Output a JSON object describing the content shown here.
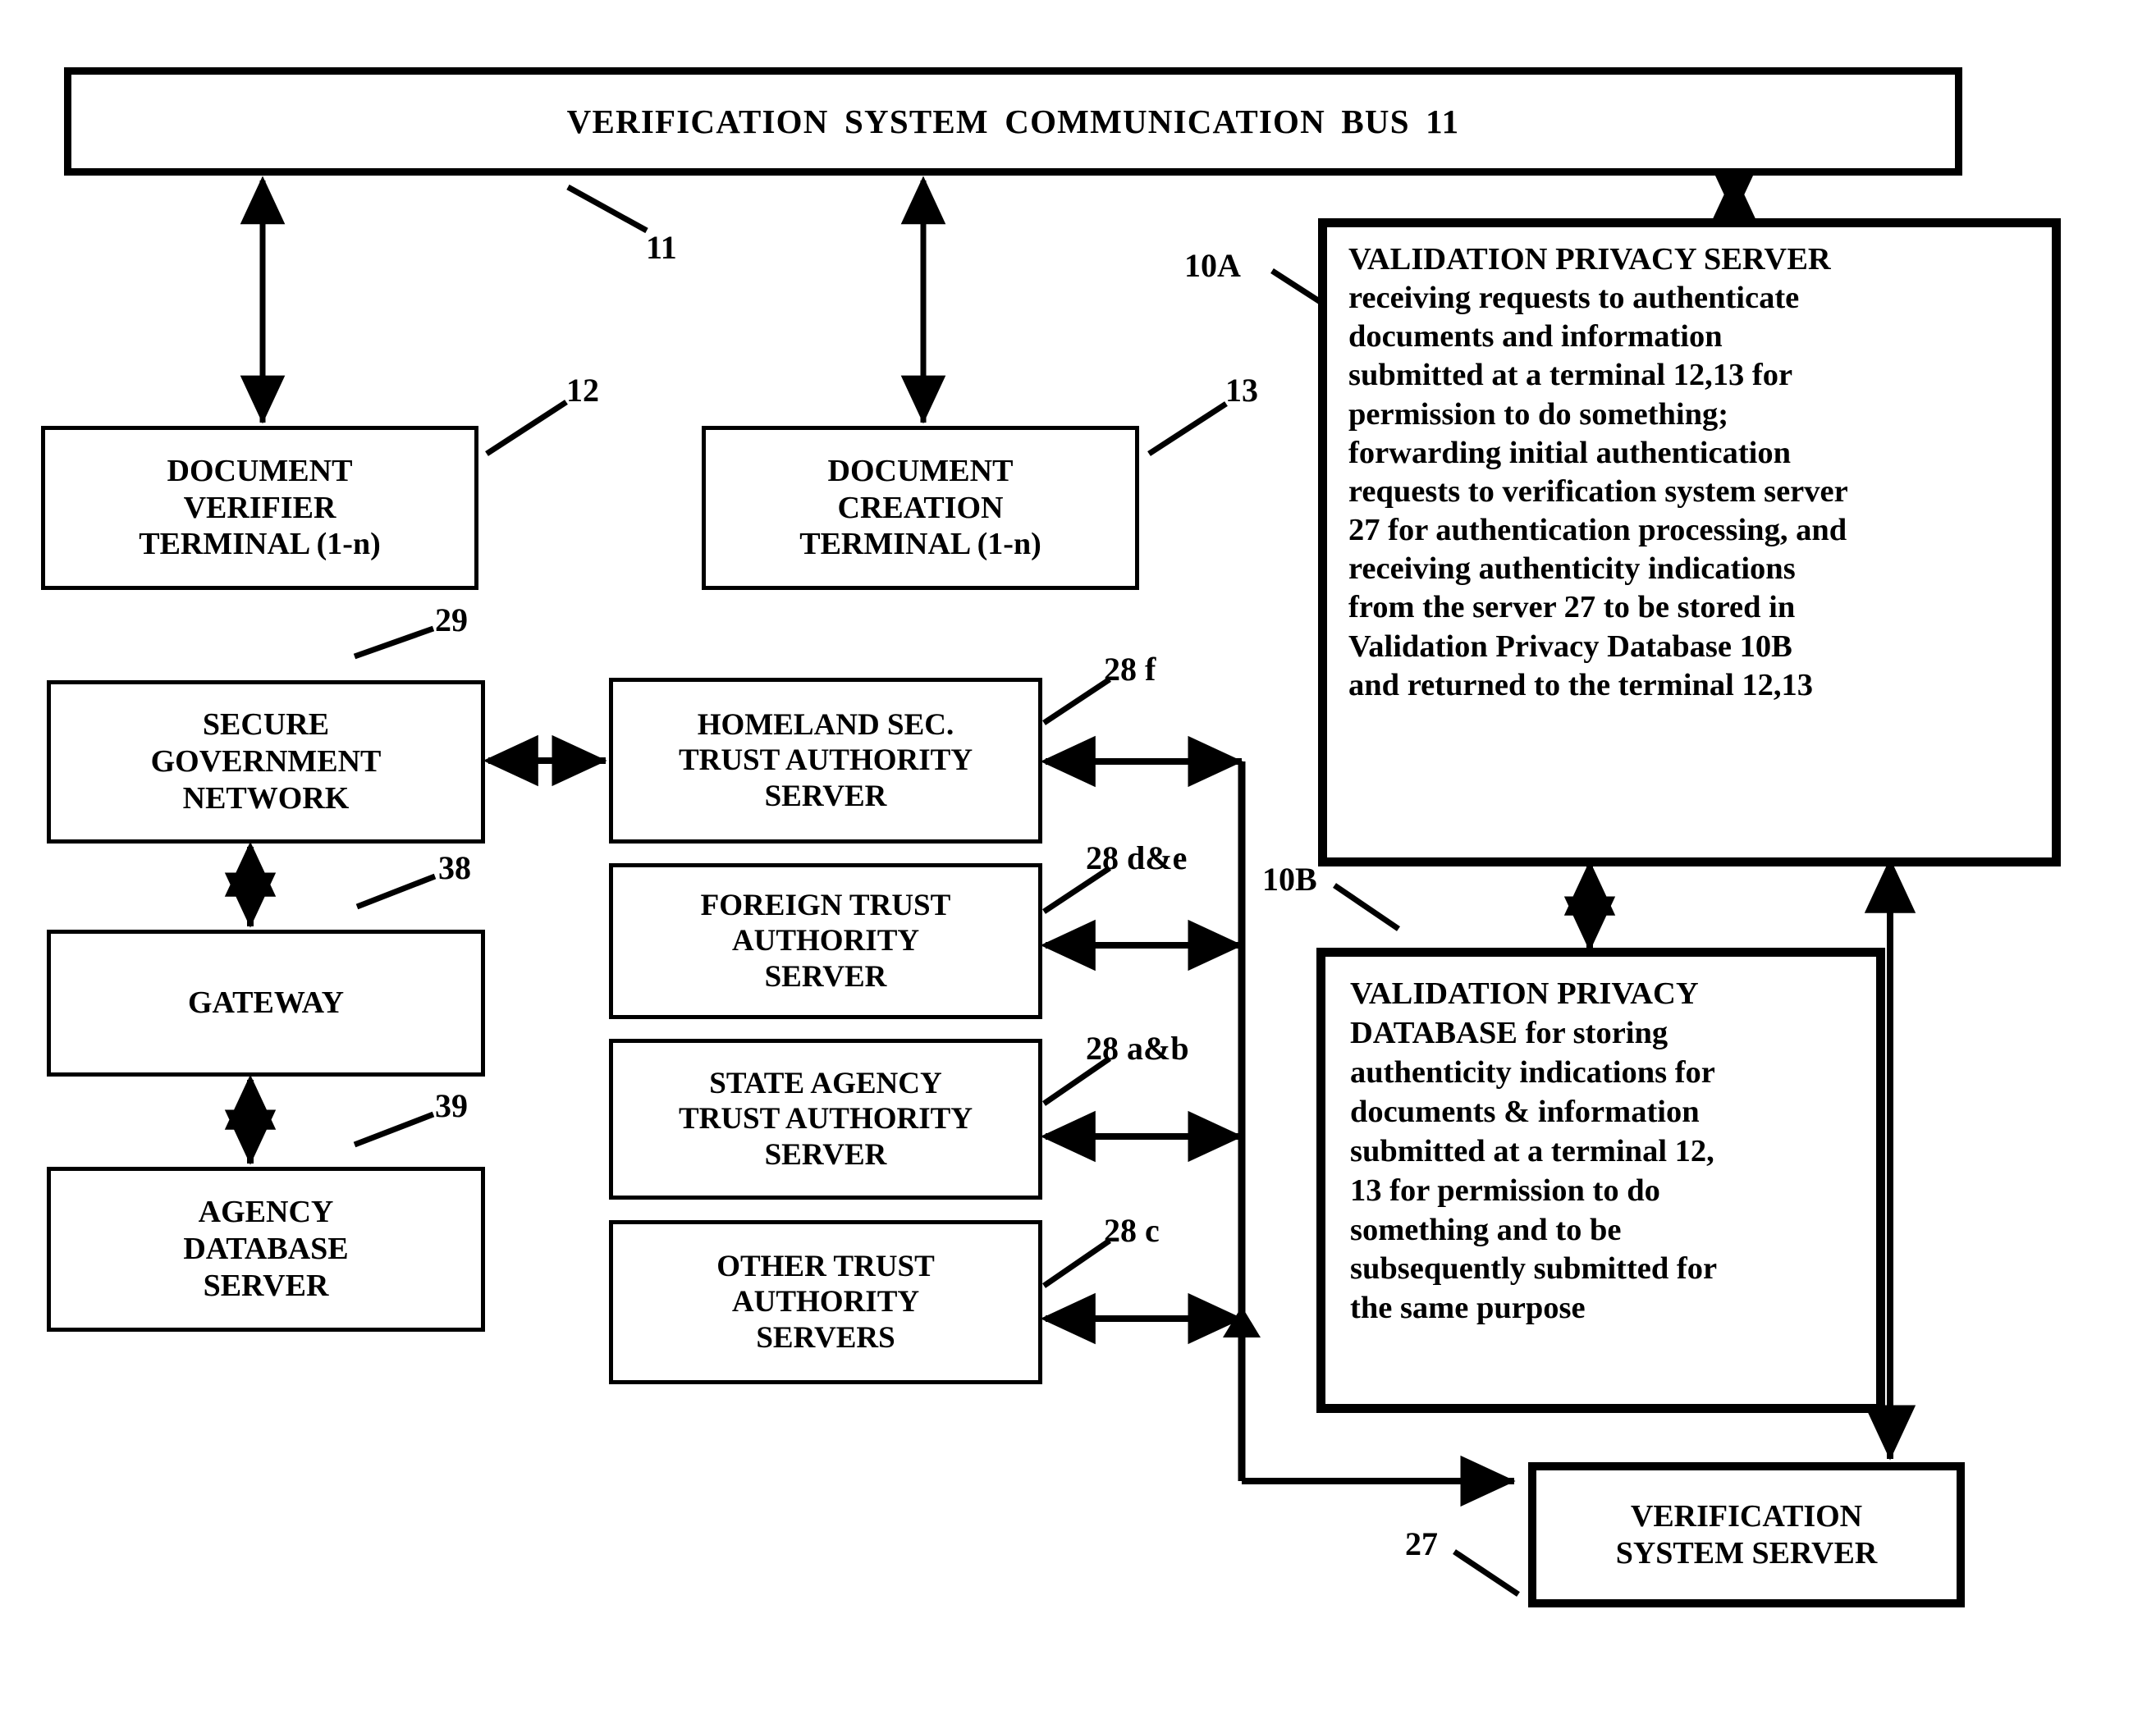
{
  "figure": {
    "type": "patent-block-diagram",
    "title": "VERIFICATION  SYSTEM  COMMUNICATION  BUS  11"
  },
  "bus": {
    "label": "VERIFICATION  SYSTEM  COMMUNICATION  BUS  11",
    "ref": "11"
  },
  "boxes": {
    "document_verifier_terminal": {
      "lines": [
        "DOCUMENT",
        "VERIFIER",
        "TERMINAL (1-n)"
      ],
      "ref": "12"
    },
    "document_creation_terminal": {
      "lines": [
        "DOCUMENT",
        "CREATION",
        "TERMINAL (1-n)"
      ],
      "ref": "13"
    },
    "secure_government_network": {
      "lines": [
        "SECURE",
        "GOVERNMENT",
        "NETWORK"
      ],
      "ref": "29"
    },
    "gateway": {
      "lines": [
        "GATEWAY"
      ],
      "ref": "38"
    },
    "agency_database_server": {
      "lines": [
        "AGENCY",
        "DATABASE",
        "SERVER"
      ],
      "ref": "39"
    },
    "homeland_sec_trust_authority_server": {
      "lines": [
        "HOMELAND SEC.",
        "TRUST AUTHORITY",
        "SERVER"
      ],
      "ref": "28 f"
    },
    "foreign_trust_authority_server": {
      "lines": [
        "FOREIGN TRUST",
        "AUTHORITY",
        "SERVER"
      ],
      "ref": "28 d&e"
    },
    "state_agency_trust_authority_server": {
      "lines": [
        "STATE AGENCY",
        "TRUST AUTHORITY",
        "SERVER"
      ],
      "ref": "28 a&b"
    },
    "other_trust_authority_servers": {
      "lines": [
        "OTHER TRUST",
        "AUTHORITY",
        "SERVERS"
      ],
      "ref": "28 c"
    },
    "validation_privacy_server": {
      "ref": "10A",
      "text": "VALIDATION PRIVACY SERVER receiving requests to authenticate documents and information submitted at a terminal 12,13 for permission to do something; forwarding initial authentication requests to verification system server 27 for authentication processing, and receiving authenticity indications from the server 27 to be stored in Validation Privacy Database 10B and returned to the terminal 12,13",
      "lines": [
        "VALIDATION PRIVACY SERVER",
        "receiving requests to authenticate",
        "documents and information",
        "submitted at a terminal 12,13 for",
        "permission to do something;",
        "forwarding initial authentication",
        "requests to verification system server",
        "27 for authentication processing, and",
        "receiving authenticity indications",
        "from the server 27 to be stored in",
        "Validation Privacy Database 10B",
        "and returned to the terminal 12,13"
      ]
    },
    "validation_privacy_database": {
      "ref": "10B",
      "text": "VALIDATION PRIVACY DATABASE for storing authenticity indications for documents & information submitted at a terminal 12, 13 for permission to do something and to be subsequently submitted for the same purpose",
      "lines": [
        "VALIDATION PRIVACY",
        "DATABASE for storing",
        "authenticity indications for",
        "documents & information",
        "submitted at a terminal 12,",
        "13 for permission to do",
        "something and to be",
        "subsequently submitted for",
        "the same purpose"
      ]
    },
    "verification_system_server": {
      "lines": [
        "VERIFICATION",
        "SYSTEM SERVER"
      ],
      "ref": "27"
    }
  },
  "refs": {
    "bus": "11",
    "doc_verifier": "12",
    "doc_creation": "13",
    "secure_net": "29",
    "gateway": "38",
    "agency_db": "39",
    "homeland": "28 f",
    "foreign": "28 d&e",
    "state": "28 a&b",
    "other": "28 c",
    "vps": "10A",
    "vpdb": "10B",
    "vss": "27"
  },
  "colors": {
    "stroke": "#000000",
    "background": "#ffffff"
  }
}
